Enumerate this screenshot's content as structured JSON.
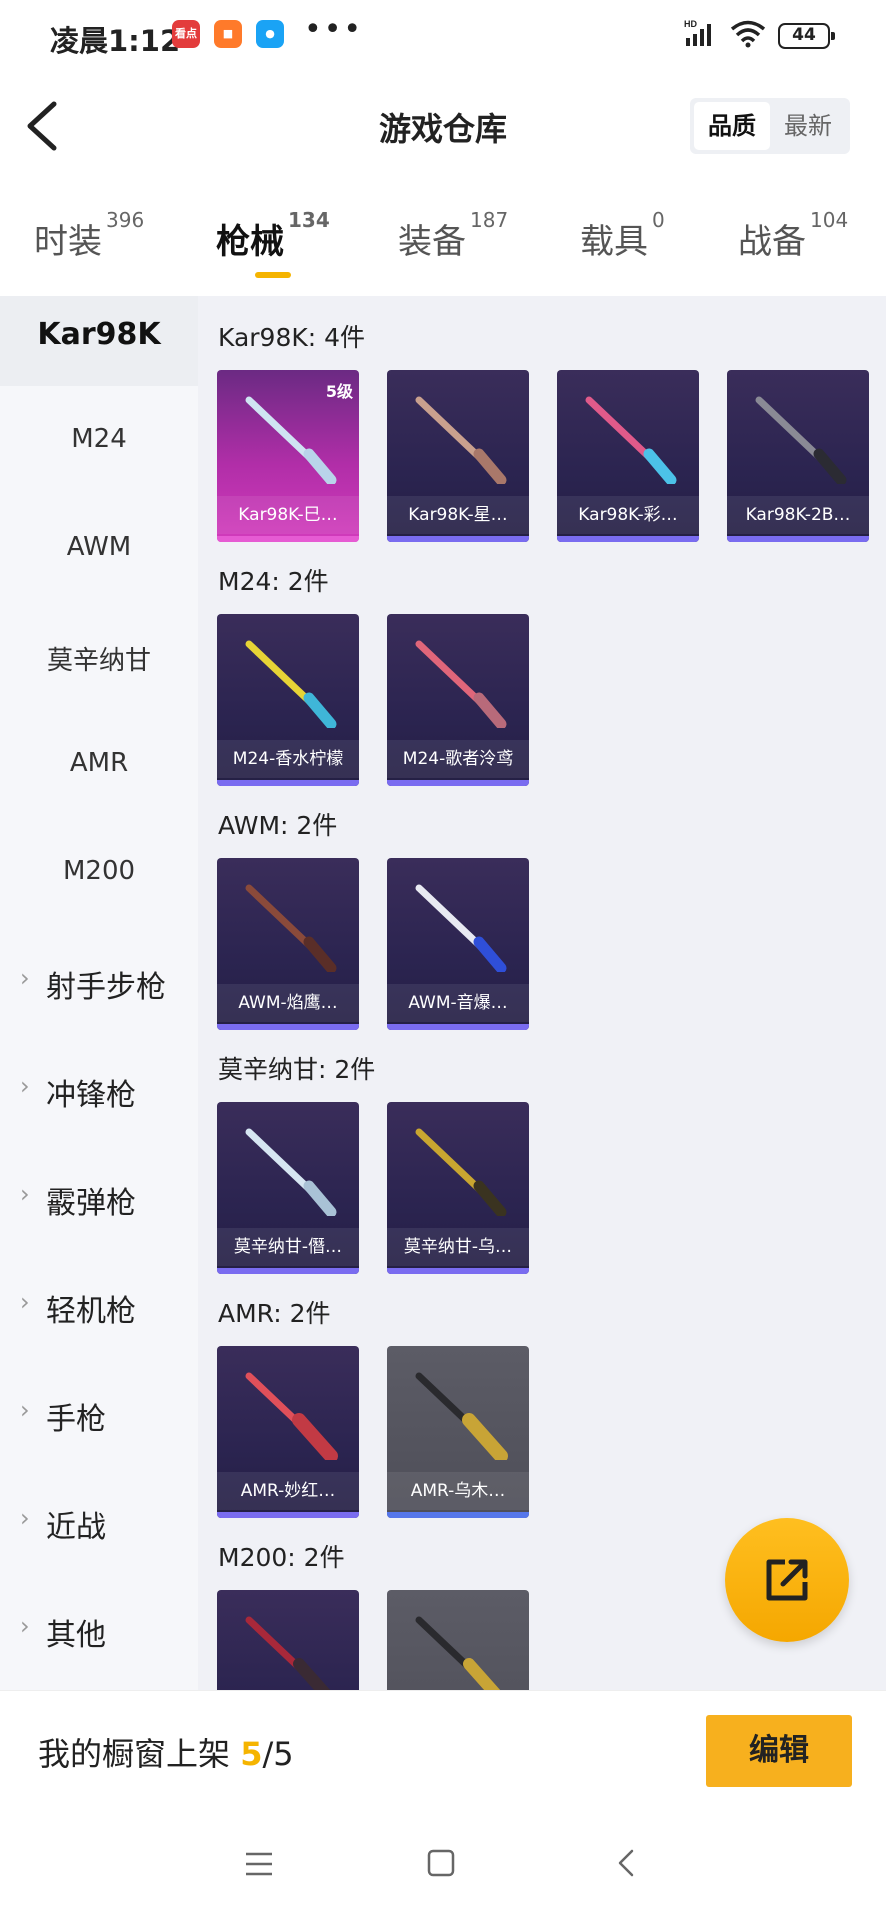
{
  "status_bar": {
    "time": "凌晨1:12",
    "battery": "44",
    "app1": "看点"
  },
  "header": {
    "title": "游戏仓库",
    "sort_quality": "品质",
    "sort_newest": "最新"
  },
  "tabs": [
    {
      "label": "时装",
      "count": "396"
    },
    {
      "label": "枪械",
      "count": "134"
    },
    {
      "label": "装备",
      "count": "187"
    },
    {
      "label": "载具",
      "count": "0"
    },
    {
      "label": "战备",
      "count": "104"
    }
  ],
  "sidebar": {
    "items": [
      "Kar98K",
      "M24",
      "AWM",
      "莫辛纳甘",
      "AMR",
      "M200"
    ],
    "categories": [
      "射手步枪",
      "冲锋枪",
      "霰弹枪",
      "轻机枪",
      "手枪",
      "近战",
      "其他"
    ]
  },
  "sections": [
    {
      "title": "Kar98K: 4件",
      "items": [
        "Kar98K-巳…",
        "Kar98K-星…",
        "Kar98K-彩…",
        "Kar98K-2B…"
      ],
      "level": "5级"
    },
    {
      "title": "M24: 2件",
      "items": [
        "M24-香水柠檬",
        "M24-歌者泠鸢"
      ]
    },
    {
      "title": "AWM: 2件",
      "items": [
        "AWM-焰鹰…",
        "AWM-音爆…"
      ]
    },
    {
      "title": "莫辛纳甘: 2件",
      "items": [
        "莫辛纳甘-僭…",
        "莫辛纳甘-乌…"
      ]
    },
    {
      "title": "AMR: 2件",
      "items": [
        "AMR-妙红…",
        "AMR-乌木…"
      ]
    },
    {
      "title": "M200: 2件",
      "items": [
        "",
        ""
      ]
    }
  ],
  "footer": {
    "label": "我的橱窗上架",
    "current": "5",
    "total": "/5",
    "edit": "编辑"
  },
  "colors": {
    "accent": "#f5b400",
    "card_bg": "#2b2450",
    "pink_card": "#b12ea8"
  }
}
